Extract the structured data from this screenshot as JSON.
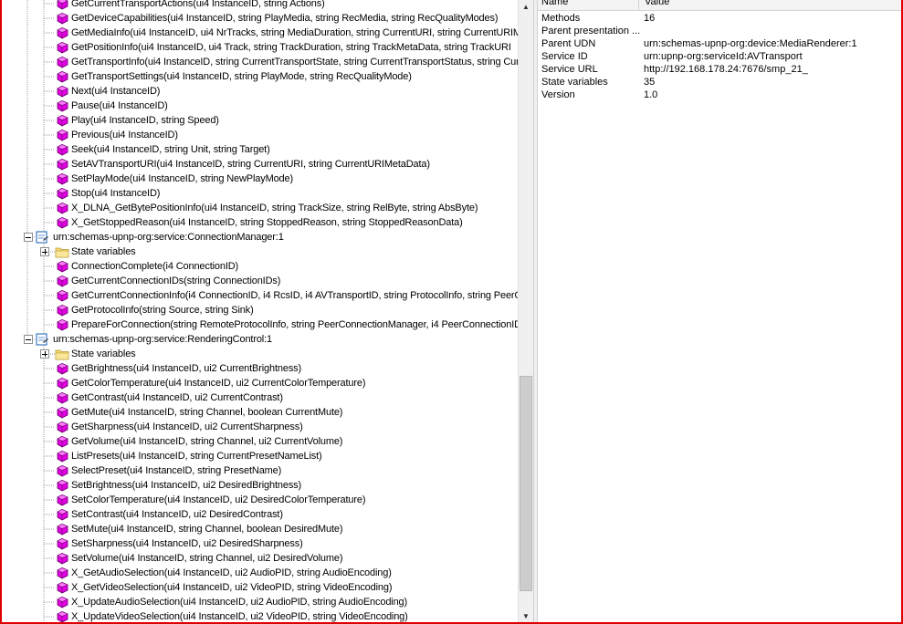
{
  "tree": {
    "rows": [
      {
        "kind": "method",
        "indent": 2,
        "text": "GetCurrentTransportActions(ui4 InstanceID, string Actions)"
      },
      {
        "kind": "method",
        "indent": 2,
        "text": "GetDeviceCapabilities(ui4 InstanceID, string PlayMedia, string RecMedia, string RecQualityModes)"
      },
      {
        "kind": "method",
        "indent": 2,
        "text": "GetMediaInfo(ui4 InstanceID, ui4 NrTracks, string MediaDuration, string CurrentURI, string CurrentURIM"
      },
      {
        "kind": "method",
        "indent": 2,
        "text": "GetPositionInfo(ui4 InstanceID, ui4 Track, string TrackDuration, string TrackMetaData, string TrackURI"
      },
      {
        "kind": "method",
        "indent": 2,
        "text": "GetTransportInfo(ui4 InstanceID, string CurrentTransportState, string CurrentTransportStatus, string Curre"
      },
      {
        "kind": "method",
        "indent": 2,
        "text": "GetTransportSettings(ui4 InstanceID, string PlayMode, string RecQualityMode)"
      },
      {
        "kind": "method",
        "indent": 2,
        "text": "Next(ui4 InstanceID)"
      },
      {
        "kind": "method",
        "indent": 2,
        "text": "Pause(ui4 InstanceID)"
      },
      {
        "kind": "method",
        "indent": 2,
        "text": "Play(ui4 InstanceID, string Speed)"
      },
      {
        "kind": "method",
        "indent": 2,
        "text": "Previous(ui4 InstanceID)"
      },
      {
        "kind": "method",
        "indent": 2,
        "text": "Seek(ui4 InstanceID, string Unit, string Target)"
      },
      {
        "kind": "method",
        "indent": 2,
        "text": "SetAVTransportURI(ui4 InstanceID, string CurrentURI, string CurrentURIMetaData)"
      },
      {
        "kind": "method",
        "indent": 2,
        "text": "SetPlayMode(ui4 InstanceID, string NewPlayMode)"
      },
      {
        "kind": "method",
        "indent": 2,
        "text": "Stop(ui4 InstanceID)"
      },
      {
        "kind": "method",
        "indent": 2,
        "text": "X_DLNA_GetBytePositionInfo(ui4 InstanceID, string TrackSize, string RelByte, string AbsByte)"
      },
      {
        "kind": "method",
        "indent": 2,
        "text": "X_GetStoppedReason(ui4 InstanceID, string StoppedReason, string StoppedReasonData)"
      },
      {
        "kind": "service",
        "indent": 1,
        "text": "urn:schemas-upnp-org:service:ConnectionManager:1"
      },
      {
        "kind": "folder",
        "indent": 2,
        "text": "State variables"
      },
      {
        "kind": "method",
        "indent": 2,
        "text": "ConnectionComplete(i4 ConnectionID)"
      },
      {
        "kind": "method",
        "indent": 2,
        "text": "GetCurrentConnectionIDs(string ConnectionIDs)"
      },
      {
        "kind": "method",
        "indent": 2,
        "text": "GetCurrentConnectionInfo(i4 ConnectionID, i4 RcsID, i4 AVTransportID, string ProtocolInfo, string PeerC"
      },
      {
        "kind": "method",
        "indent": 2,
        "text": "GetProtocolInfo(string Source, string Sink)"
      },
      {
        "kind": "method",
        "indent": 2,
        "text": "PrepareForConnection(string RemoteProtocolInfo, string PeerConnectionManager, i4 PeerConnectionID"
      },
      {
        "kind": "service",
        "indent": 1,
        "text": "urn:schemas-upnp-org:service:RenderingControl:1"
      },
      {
        "kind": "folder",
        "indent": 2,
        "text": "State variables"
      },
      {
        "kind": "method",
        "indent": 2,
        "text": "GetBrightness(ui4 InstanceID, ui2 CurrentBrightness)"
      },
      {
        "kind": "method",
        "indent": 2,
        "text": "GetColorTemperature(ui4 InstanceID, ui2 CurrentColorTemperature)"
      },
      {
        "kind": "method",
        "indent": 2,
        "text": "GetContrast(ui4 InstanceID, ui2 CurrentContrast)"
      },
      {
        "kind": "method",
        "indent": 2,
        "text": "GetMute(ui4 InstanceID, string Channel, boolean CurrentMute)"
      },
      {
        "kind": "method",
        "indent": 2,
        "text": "GetSharpness(ui4 InstanceID, ui2 CurrentSharpness)"
      },
      {
        "kind": "method",
        "indent": 2,
        "text": "GetVolume(ui4 InstanceID, string Channel, ui2 CurrentVolume)"
      },
      {
        "kind": "method",
        "indent": 2,
        "text": "ListPresets(ui4 InstanceID, string CurrentPresetNameList)"
      },
      {
        "kind": "method",
        "indent": 2,
        "text": "SelectPreset(ui4 InstanceID, string PresetName)"
      },
      {
        "kind": "method",
        "indent": 2,
        "text": "SetBrightness(ui4 InstanceID, ui2 DesiredBrightness)"
      },
      {
        "kind": "method",
        "indent": 2,
        "text": "SetColorTemperature(ui4 InstanceID, ui2 DesiredColorTemperature)"
      },
      {
        "kind": "method",
        "indent": 2,
        "text": "SetContrast(ui4 InstanceID, ui2 DesiredContrast)"
      },
      {
        "kind": "method",
        "indent": 2,
        "text": "SetMute(ui4 InstanceID, string Channel, boolean DesiredMute)"
      },
      {
        "kind": "method",
        "indent": 2,
        "text": "SetSharpness(ui4 InstanceID, ui2 DesiredSharpness)"
      },
      {
        "kind": "method",
        "indent": 2,
        "text": "SetVolume(ui4 InstanceID, string Channel, ui2 DesiredVolume)"
      },
      {
        "kind": "method",
        "indent": 2,
        "text": "X_GetAudioSelection(ui4 InstanceID, ui2 AudioPID, string AudioEncoding)"
      },
      {
        "kind": "method",
        "indent": 2,
        "text": "X_GetVideoSelection(ui4 InstanceID, ui2 VideoPID, string VideoEncoding)"
      },
      {
        "kind": "method",
        "indent": 2,
        "text": "X_UpdateAudioSelection(ui4 InstanceID, ui2 AudioPID, string AudioEncoding)"
      },
      {
        "kind": "method",
        "indent": 2,
        "text": "X_UpdateVideoSelection(ui4 InstanceID, ui2 VideoPID, string VideoEncoding)"
      }
    ],
    "icons": {
      "method": "method-cube-icon",
      "service": "service-document-icon",
      "folder": "folder-icon"
    }
  },
  "scrollbar": {
    "up_icon": "scroll-up-arrow-icon",
    "down_icon": "scroll-down-arrow-icon"
  },
  "properties": {
    "columns": {
      "name": "Name",
      "value": "Value"
    },
    "rows": [
      {
        "name": "Methods",
        "value": "16"
      },
      {
        "name": "Parent presentation ...",
        "value": ""
      },
      {
        "name": "Parent UDN",
        "value": "urn:schemas-upnp-org:device:MediaRenderer:1"
      },
      {
        "name": "Service ID",
        "value": "urn:upnp-org:serviceId:AVTransport"
      },
      {
        "name": "Service URL",
        "value": "http://192.168.178.24:7676/smp_21_"
      },
      {
        "name": "State variables",
        "value": "35"
      },
      {
        "name": "Version",
        "value": "1.0"
      }
    ]
  },
  "colors": {
    "frame": "#e00000",
    "method_icon": "#e000e0",
    "folder_icon": "#f5d76e",
    "service_icon": "#3a78c2"
  }
}
